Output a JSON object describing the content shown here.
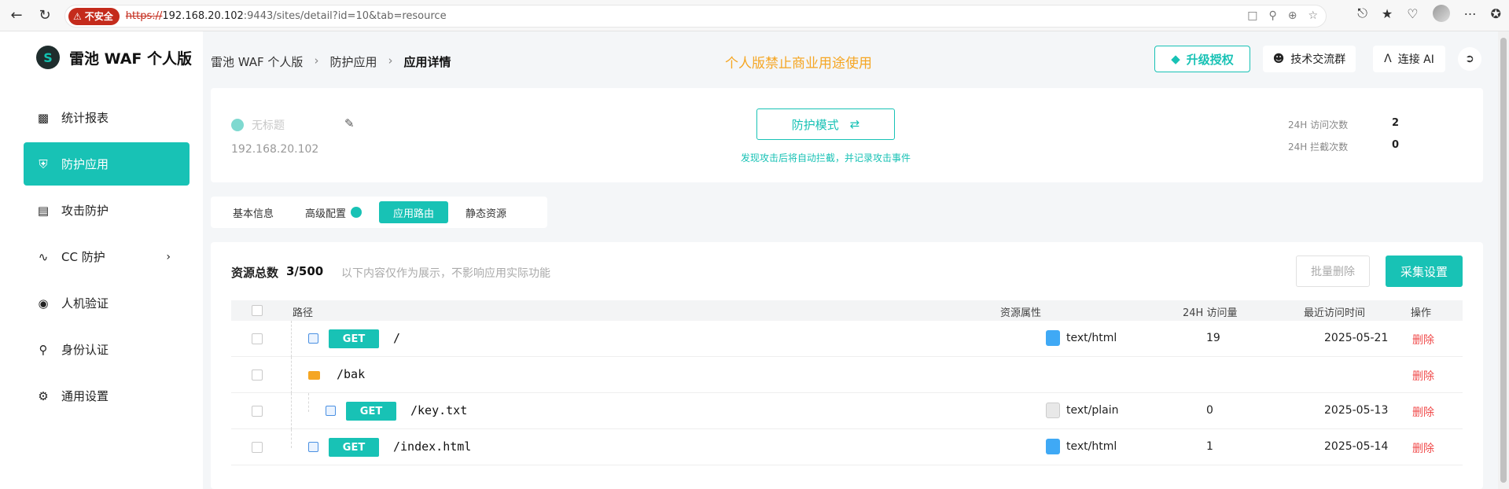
{
  "browser": {
    "insecure_label": "不安全",
    "url_scheme": "https://",
    "url_host": "192.168.20.102",
    "url_rest": ":9443/sites/detail?id=10&tab=resource"
  },
  "sidebar": {
    "logo_text": "雷池 WAF 个人版",
    "items": [
      {
        "label": "统计报表",
        "icon": "bar-chart-icon"
      },
      {
        "label": "防护应用",
        "icon": "shield-icon"
      },
      {
        "label": "攻击防护",
        "icon": "document-icon"
      },
      {
        "label": "CC 防护",
        "icon": "pulse-icon"
      },
      {
        "label": "人机验证",
        "icon": "robot-icon"
      },
      {
        "label": "身份认证",
        "icon": "key-icon"
      },
      {
        "label": "通用设置",
        "icon": "gear-icon"
      }
    ]
  },
  "header": {
    "breadcrumb": [
      "雷池 WAF 个人版",
      "防护应用",
      "应用详情"
    ],
    "notice": "个人版禁止商业用途使用",
    "upgrade_label": "升级授权",
    "community_label": "技术交流群",
    "ai_label": "连接 AI"
  },
  "site": {
    "title": "无标题",
    "ip": "192.168.20.102",
    "mode_label": "防护模式",
    "mode_desc": "发现攻击后将自动拦截，并记录攻击事件",
    "stats": [
      {
        "label": "24H 访问次数",
        "value": "2"
      },
      {
        "label": "24H 拦截次数",
        "value": "0"
      }
    ]
  },
  "tabs": [
    "基本信息",
    "高级配置",
    "应用路由",
    "静态资源"
  ],
  "resources": {
    "total_label": "资源总数",
    "total_value": "3/500",
    "hint": "以下内容仅作为展示，不影响应用实际功能",
    "batch_delete_label": "批量删除",
    "collect_settings_label": "采集设置",
    "columns": [
      "路径",
      "资源属性",
      "24H 访问量",
      "最近访问时间",
      "操作"
    ],
    "rows": [
      {
        "method": "GET",
        "path": "/",
        "attr": "text/html",
        "visits": "19",
        "time": "2025-05-21",
        "op": "删除"
      },
      {
        "method": "",
        "path": "/bak",
        "attr": "",
        "visits": "",
        "time": "",
        "op": "删除"
      },
      {
        "method": "GET",
        "path": "/key.txt",
        "attr": "text/plain",
        "visits": "0",
        "time": "2025-05-13",
        "op": "删除"
      },
      {
        "method": "GET",
        "path": "/index.html",
        "attr": "text/html",
        "visits": "1",
        "time": "2025-05-14",
        "op": "删除"
      }
    ]
  }
}
